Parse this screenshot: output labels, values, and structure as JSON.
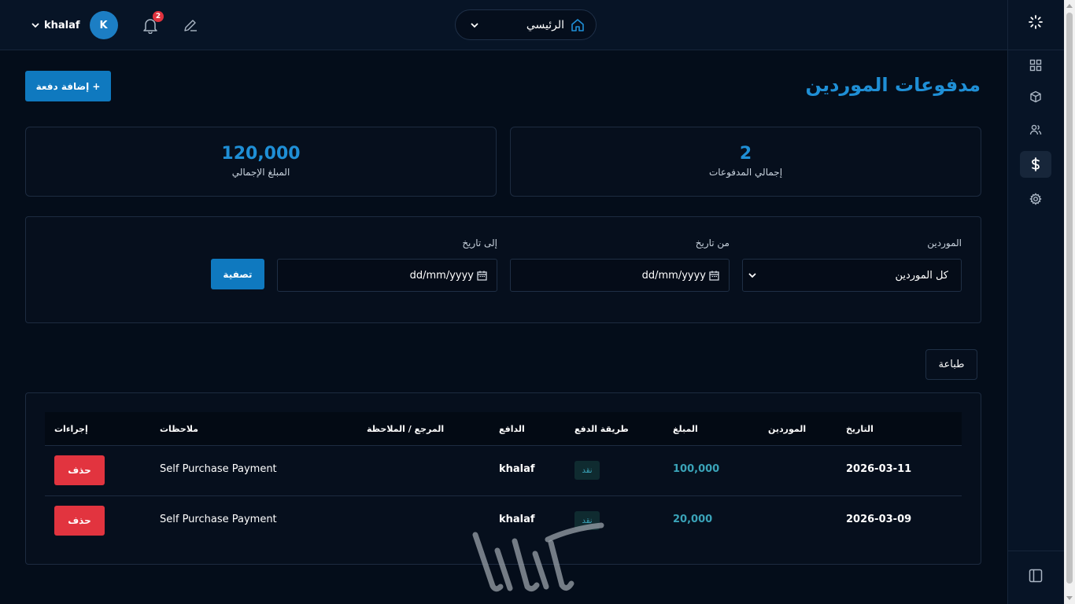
{
  "header": {
    "username": "khalaf",
    "avatar_letter": "K",
    "notification_count": "2",
    "nav_label": "الرئيسي"
  },
  "page": {
    "title": "مدفوعات الموردين",
    "add_button": "+ إضافة دفعة"
  },
  "stats": {
    "total_payments_value": "2",
    "total_payments_label": "إجمالي المدفوعات",
    "total_amount_value": "120,000",
    "total_amount_label": "المبلغ الإجمالي"
  },
  "filters": {
    "supplier_label": "الموردين",
    "supplier_value": "كل الموردين",
    "from_label": "من تاريخ",
    "from_value": "dd/mm/yyyy",
    "to_label": "إلى تاريخ",
    "to_value": "dd/mm/yyyy",
    "filter_button": "تصفية"
  },
  "print_button": "طباعة",
  "table": {
    "columns": [
      "التاريخ",
      "الموردين",
      "المبلغ",
      "طريقة الدفع",
      "الدافع",
      "المرجع / الملاحظة",
      "ملاحظات",
      "إجراءات"
    ],
    "rows": [
      {
        "date": "2026-03-11",
        "supplier": "",
        "amount": "100,000",
        "method": "نقد",
        "payer": "khalaf",
        "reference": "",
        "notes": "Self Purchase Payment",
        "action": "حذف"
      },
      {
        "date": "2026-03-09",
        "supplier": "",
        "amount": "20,000",
        "method": "نقد",
        "payer": "khalaf",
        "reference": "",
        "notes": "Self Purchase Payment",
        "action": "حذف"
      }
    ]
  },
  "sidebar": {
    "items": [
      "loader-icon",
      "dashboard-grid-icon",
      "box-icon",
      "users-icon",
      "dollar-icon",
      "settings-icon",
      "sidebar-toggle-icon"
    ],
    "active": "dollar-icon"
  },
  "colors": {
    "accent": "#1f8fd6",
    "button": "#0f79bf",
    "danger": "#e2343f",
    "amount": "#3aa3b8",
    "background": "#040d1a"
  }
}
